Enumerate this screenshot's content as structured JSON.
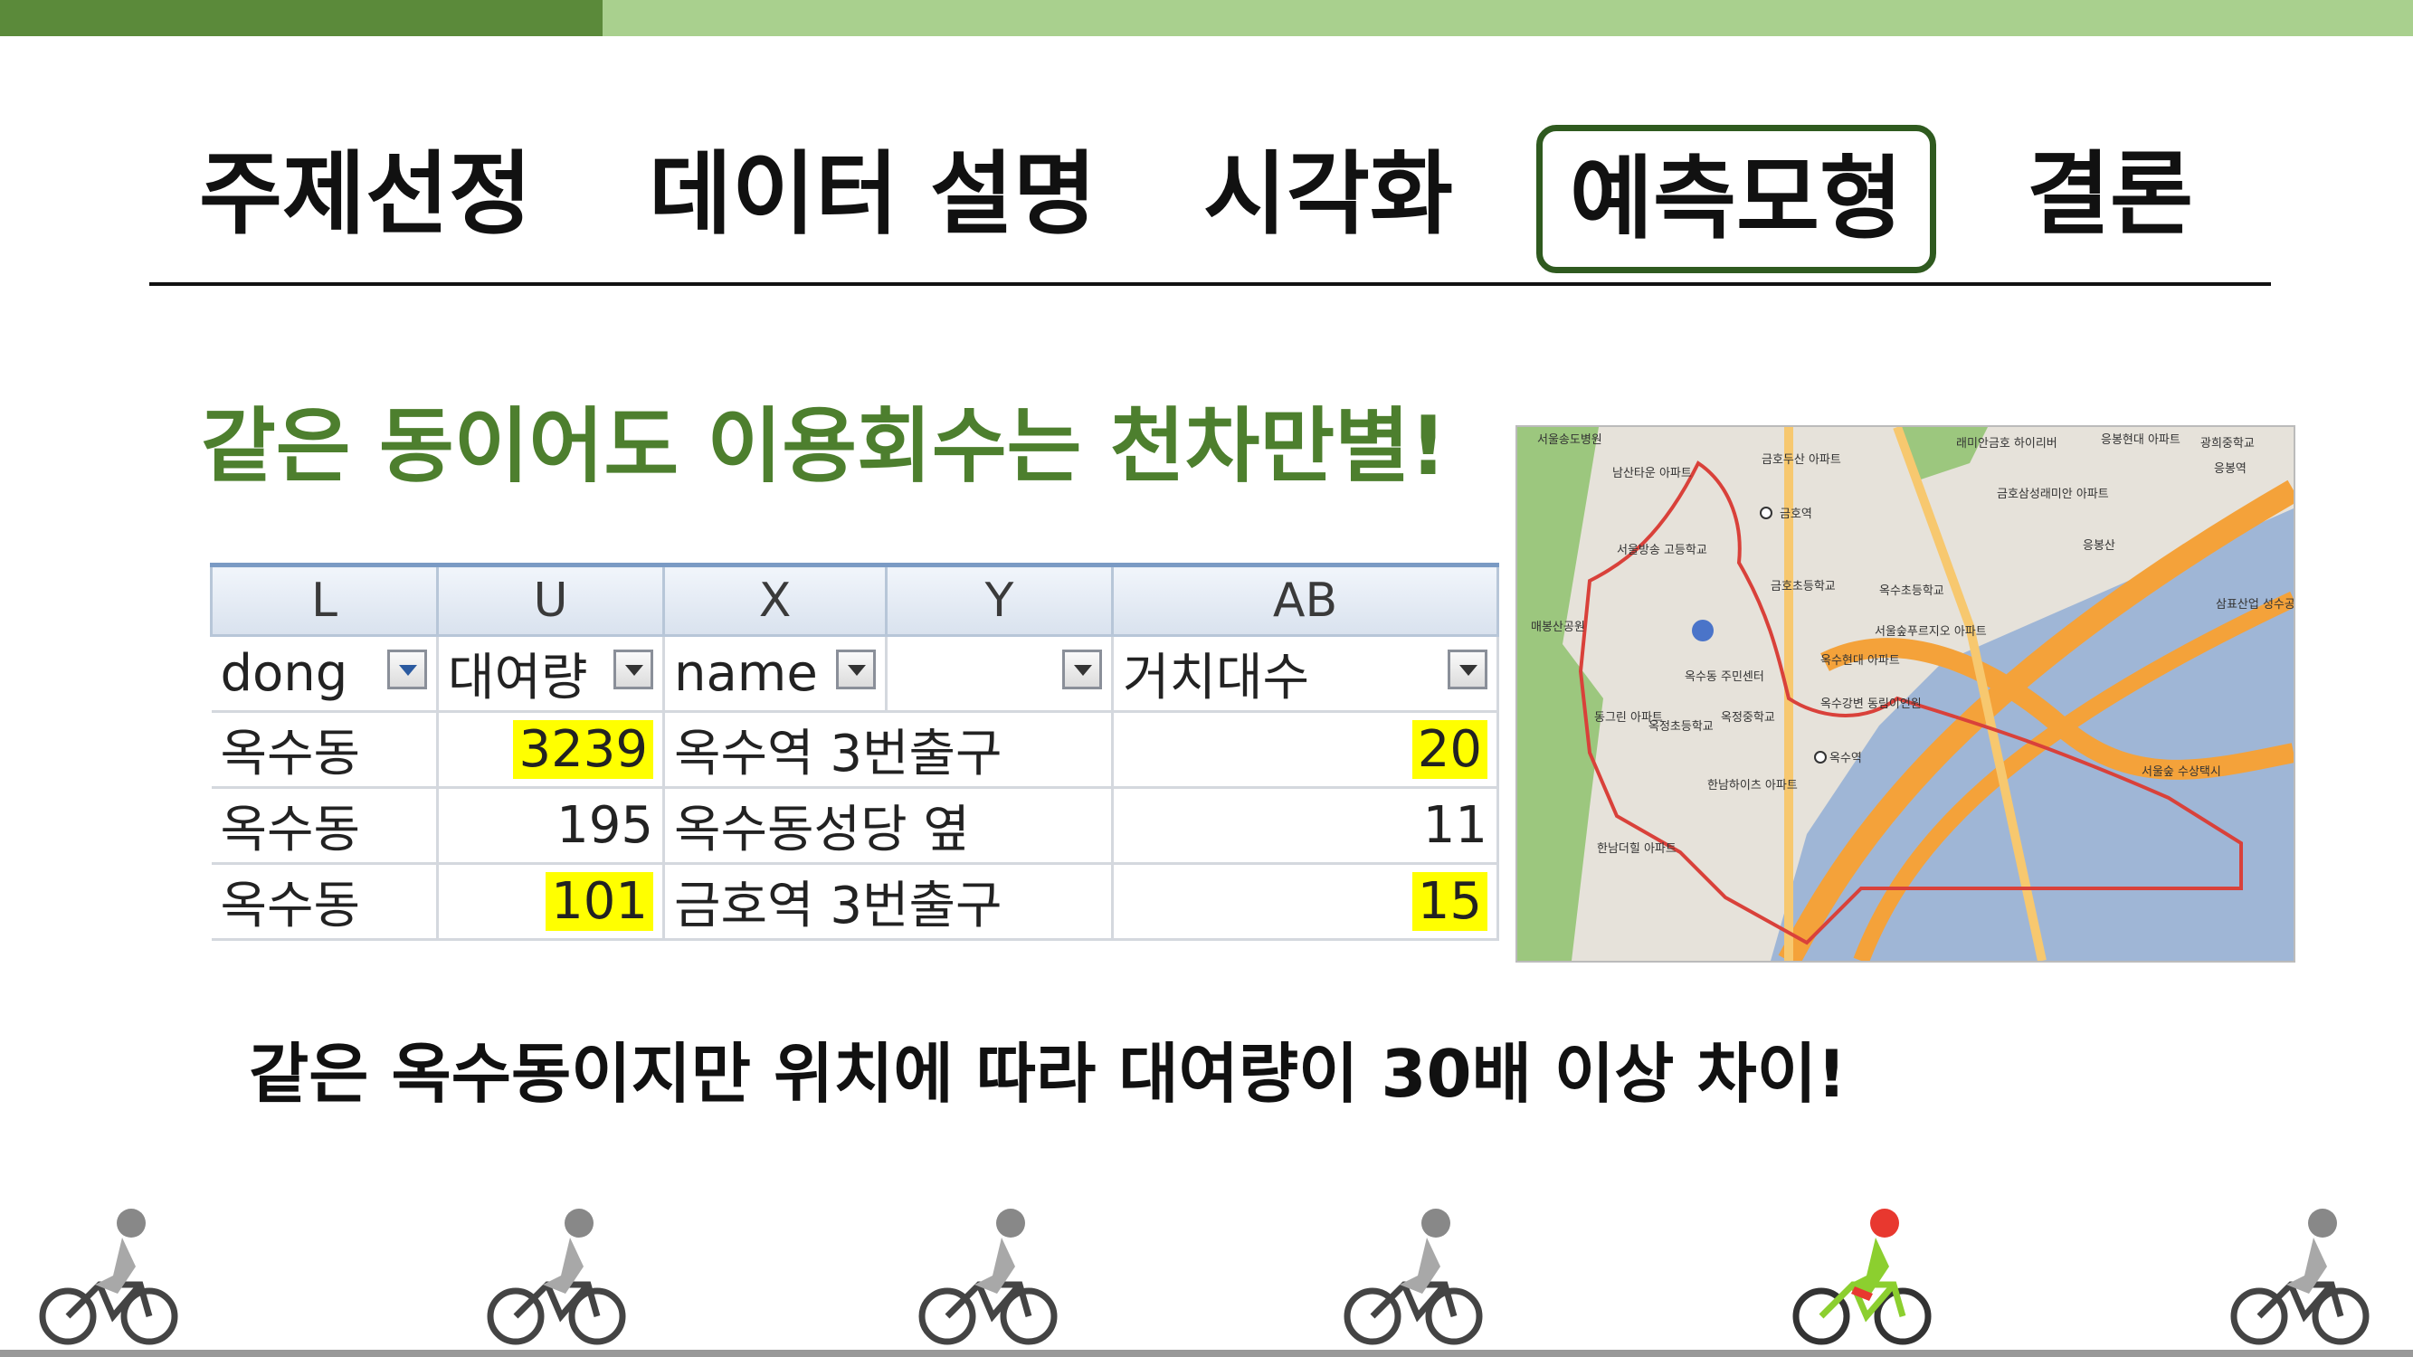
{
  "nav": {
    "items": [
      {
        "label": "주제선정",
        "active": false
      },
      {
        "label": "데이터 설명",
        "active": false
      },
      {
        "label": "시각화",
        "active": false
      },
      {
        "label": "예측모형",
        "active": true
      },
      {
        "label": "결론",
        "active": false
      }
    ]
  },
  "headline": "같은 동이어도 이용회수는 천차만별!",
  "sheet": {
    "column_letters": [
      "L",
      "U",
      "X",
      "Y",
      "AB"
    ],
    "field_headers": [
      "dong",
      "대여량",
      "name",
      "",
      "거치대수"
    ],
    "rows": [
      {
        "dong": "옥수동",
        "rentals": "3239",
        "name": "옥수역 3번출구",
        "racks": "20",
        "highlight_rentals": true,
        "highlight_racks": true
      },
      {
        "dong": "옥수동",
        "rentals": "195",
        "name": "옥수동성당 옆",
        "racks": "11",
        "highlight_rentals": false,
        "highlight_racks": false
      },
      {
        "dong": "옥수동",
        "rentals": "101",
        "name": "금호역 3번출구",
        "racks": "15",
        "highlight_rentals": true,
        "highlight_racks": true
      }
    ]
  },
  "map": {
    "labels": [
      "서울송도병원",
      "남산타운 아파트",
      "금호두산 아파트",
      "래미안금호 하이리버",
      "금호삼성래미안 아파트",
      "응봉현대 아파트",
      "광희중학교",
      "응봉역",
      "금호역",
      "서울방송 고등학교",
      "응봉산",
      "금호초등학교",
      "옥수초등학교",
      "매봉산공원",
      "옥수동 주민센터",
      "서울숲푸르지오 아파트",
      "옥수현대 아파트",
      "옥수강변 동림이언원",
      "옥수역",
      "한남하이츠 아파트",
      "한남더힐 아파트",
      "서울숲 수상택시",
      "삼표산업 성수공장",
      "동그린 아파트",
      "옥정초등학교",
      "옥정중학교"
    ],
    "colors": {
      "water": "#9fb6d6",
      "road": "#f4a23a",
      "park": "#9cc77e",
      "boundary": "#d9413a"
    }
  },
  "caption": "같은 옥수동이지만 위치에 따라 대여량이 30배 이상 차이!",
  "colors": {
    "accent_dark": "#5b8a3a",
    "accent_light": "#a9d08e",
    "headline": "#4d7f2e",
    "highlight": "#ffff00"
  },
  "riders": [
    {
      "active": false
    },
    {
      "active": false
    },
    {
      "active": false
    },
    {
      "active": false
    },
    {
      "active": true
    },
    {
      "active": false
    }
  ]
}
